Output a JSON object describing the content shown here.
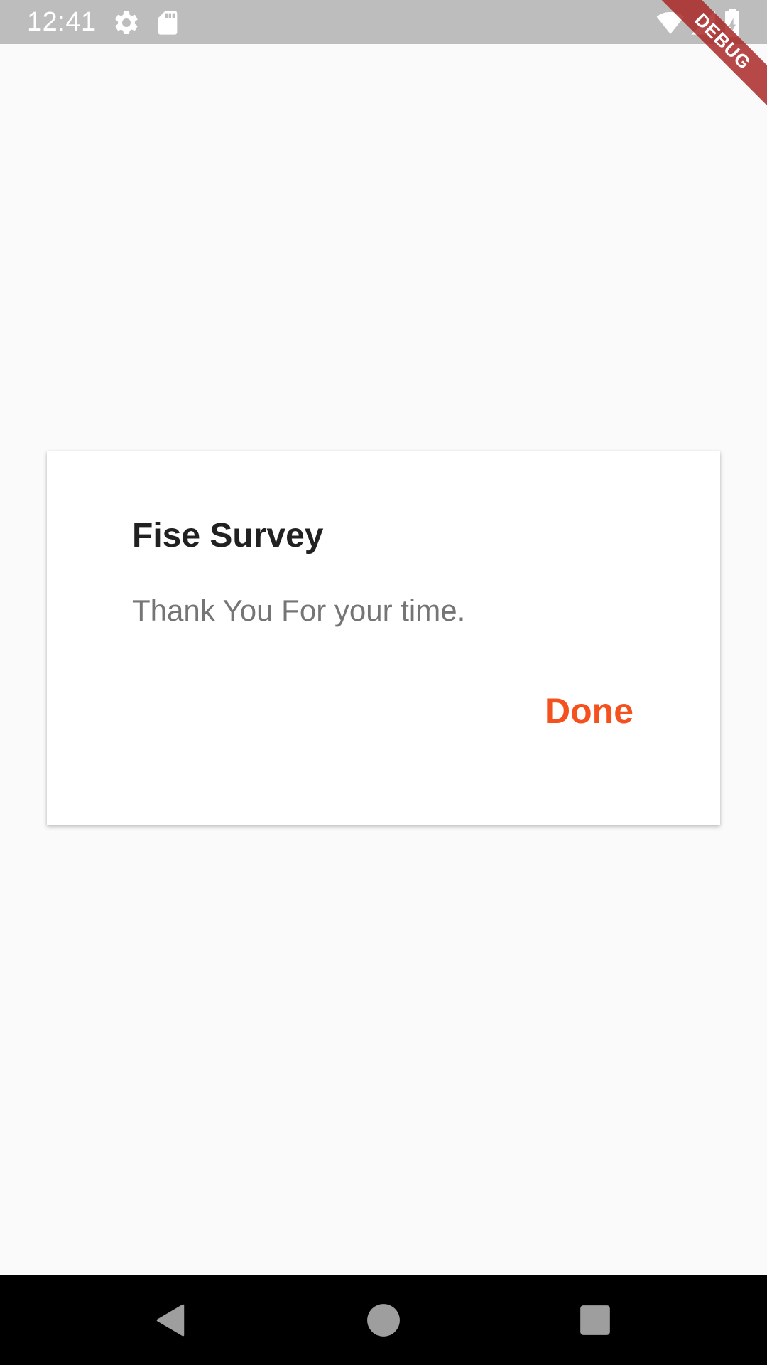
{
  "status_bar": {
    "time": "12:41",
    "icons": [
      "settings-icon",
      "sd-card-icon",
      "wifi-icon",
      "signal-icon",
      "battery-charging-icon"
    ],
    "background": "#bdbdbd"
  },
  "debug_banner": {
    "label": "DEBUG",
    "color": "#a82828"
  },
  "dialog": {
    "title": "Fise Survey",
    "message": "Thank You For your time.",
    "done_label": "Done",
    "accent_color": "#f4511e"
  },
  "nav_bar": {
    "buttons": [
      "back-icon",
      "home-icon",
      "recents-icon"
    ]
  }
}
